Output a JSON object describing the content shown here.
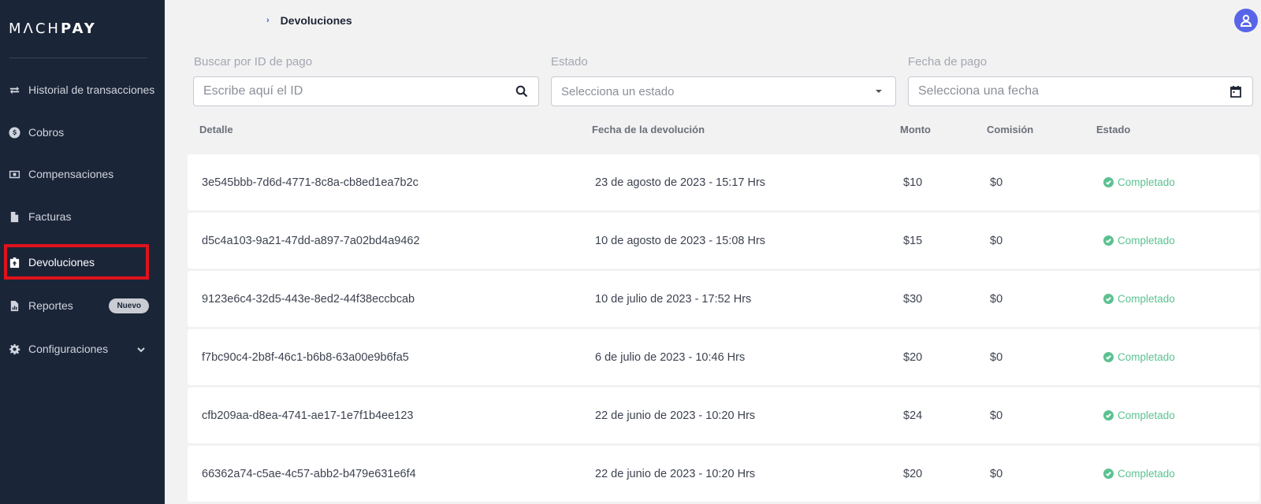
{
  "sidebar": {
    "logo_light": "MΛCH",
    "logo_bold": "PAY",
    "items": [
      {
        "label": "Historial de transacciones",
        "icon": "arrows-exchange-icon"
      },
      {
        "label": "Cobros",
        "icon": "dollar-circle-icon"
      },
      {
        "label": "Compensaciones",
        "icon": "money-bill-icon"
      },
      {
        "label": "Facturas",
        "icon": "file-icon"
      },
      {
        "label": "Devoluciones",
        "icon": "return-box-icon",
        "active": true
      },
      {
        "label": "Reportes",
        "icon": "chart-file-icon",
        "badge": "Nuevo"
      },
      {
        "label": "Configuraciones",
        "icon": "gear-icon"
      }
    ]
  },
  "breadcrumb": {
    "current": "Devoluciones"
  },
  "filters": {
    "search": {
      "label": "Buscar por ID de pago",
      "placeholder": "Escribe aquí el ID"
    },
    "status": {
      "label": "Estado",
      "placeholder": "Selecciona un estado"
    },
    "date": {
      "label": "Fecha de pago",
      "placeholder": "Selecciona una fecha"
    }
  },
  "table": {
    "headers": [
      "Detalle",
      "Fecha de la devolución",
      "Monto",
      "Comisión",
      "Estado"
    ],
    "rows": [
      {
        "id": "3e545bbb-7d6d-4771-8c8a-cb8ed1ea7b2c",
        "date": "23 de agosto de 2023 - 15:17 Hrs",
        "amount": "$10",
        "fee": "$0",
        "status": "Completado"
      },
      {
        "id": "d5c4a103-9a21-47dd-a897-7a02bd4a9462",
        "date": "10 de agosto de 2023 - 15:08 Hrs",
        "amount": "$15",
        "fee": "$0",
        "status": "Completado"
      },
      {
        "id": "9123e6c4-32d5-443e-8ed2-44f38eccbcab",
        "date": "10 de julio de 2023 - 17:52 Hrs",
        "amount": "$30",
        "fee": "$0",
        "status": "Completado"
      },
      {
        "id": "f7bc90c4-2b8f-46c1-b6b8-63a00e9b6fa5",
        "date": "6 de julio de 2023 - 10:46 Hrs",
        "amount": "$20",
        "fee": "$0",
        "status": "Completado"
      },
      {
        "id": "cfb209aa-d8ea-4741-ae17-1e7f1b4ee123",
        "date": "22 de junio de 2023 - 10:20 Hrs",
        "amount": "$24",
        "fee": "$0",
        "status": "Completado"
      },
      {
        "id": "66362a74-c5ae-4c57-abb2-b479e631e6f4",
        "date": "22 de junio de 2023 - 10:20 Hrs",
        "amount": "$20",
        "fee": "$0",
        "status": "Completado"
      }
    ]
  },
  "colors": {
    "sidebar": "#1b2538",
    "accent": "#5965e8",
    "success": "#5cc191",
    "highlight": "#e0121c"
  }
}
